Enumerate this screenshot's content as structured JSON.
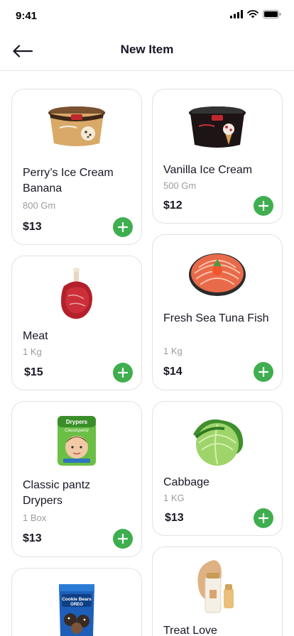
{
  "status_bar": {
    "time": "9:41"
  },
  "header": {
    "title": "New Item"
  },
  "theme": {
    "accent": "#3FAE4F",
    "text": "#181725",
    "muted": "#9C9C9C",
    "border": "#E2E2E2"
  },
  "products": [
    {
      "name": "Perry’s Ice Cream Banana",
      "quantity": "800 Gm",
      "price": "$13",
      "image": "ice-cream-tub-banana"
    },
    {
      "name": "Vanilla Ice Cream",
      "quantity": "500 Gm",
      "price": "$12",
      "image": "ice-cream-tub-vanilla"
    },
    {
      "name": "Meat",
      "quantity": "1 Kg",
      "price": "$15",
      "image": "raw-steak"
    },
    {
      "name": "Fresh Sea Tuna Fish",
      "quantity": "1 Kg",
      "price": "$14",
      "image": "tuna-sashimi-platter"
    },
    {
      "name": "Classic pantz Drypers",
      "quantity": "1 Box",
      "price": "$13",
      "image": "diaper-pack"
    },
    {
      "name": "Cabbage",
      "quantity": "1 KG",
      "price": "$13",
      "image": "cabbage"
    },
    {
      "name": "",
      "quantity": "",
      "price": "",
      "image": "cookie-snack-bag"
    },
    {
      "name": "Treat Love",
      "quantity": "",
      "price": "",
      "image": "cosmetic-foundation"
    }
  ],
  "product_images": {
    "ice-cream-tub-banana": "Drypers",
    "diaper-pack_brand": "Drypers",
    "diaper-pack_sub": "Classicpantz",
    "snack_brand": "Cookie Bears",
    "snack_sub": "OREO"
  }
}
